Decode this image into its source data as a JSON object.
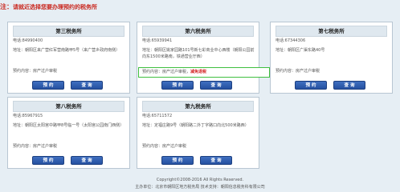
{
  "notice": {
    "prefix": "注：",
    "text": "请就近选择您要办理预约的税务所"
  },
  "offices": [
    {
      "title": "第三税务所",
      "phone": "电话:84990400",
      "address": "地址：朝阳区来广营红军营南路甲5号（来广营乡政府南侧）",
      "appointment_label": "预约内容：",
      "appointment_value": "房产过户审税",
      "appointment_status": "",
      "reserve_label": "预 约",
      "query_label": "查 询"
    },
    {
      "title": "第六税务所",
      "phone": "电话:65939941",
      "address": "地址：朝阳区姚家园路101号新七彩商业中心西楼（朝阳公园前向东1500米路南，铁通营业厅西）",
      "appointment_label": "预约内容：",
      "appointment_value": "房产过户审税",
      "appointment_status": "减免退税",
      "reserve_label": "预 约",
      "query_label": "查 询"
    },
    {
      "title": "第七税务所",
      "phone": "电话:67344306",
      "address": "地址：朝阳区广渠东路40号",
      "appointment_label": "预约内容：",
      "appointment_value": "房产过户审税",
      "appointment_status": "",
      "reserve_label": "预 约",
      "query_label": "查 询"
    },
    {
      "title": "第八税务所",
      "phone": "电话:85967915",
      "address": "地址：朝阳区太阳宫中路甲8号临一号（太阳宫公园南门西侧）",
      "appointment_label": "预约内容：",
      "appointment_value": "房产过户审税",
      "appointment_status": "",
      "reserve_label": "预 约",
      "query_label": "查 询"
    },
    {
      "title": "第九税务所",
      "phone": "电话:65711572",
      "address": "地址：定福庄路9号（朝阳路二外丁字路口向北500米路西）",
      "appointment_label": "预约内容：",
      "appointment_value": "房产过户审税",
      "appointment_status": "",
      "reserve_label": "预 约",
      "query_label": "查 询"
    }
  ],
  "footer": {
    "copyright": "Copyright©2008-2016 All Rights Reserved.",
    "partial": "主办单位：北京市朝阳区地方税务局  技术支持：朝阳信息税务科有限公司"
  }
}
